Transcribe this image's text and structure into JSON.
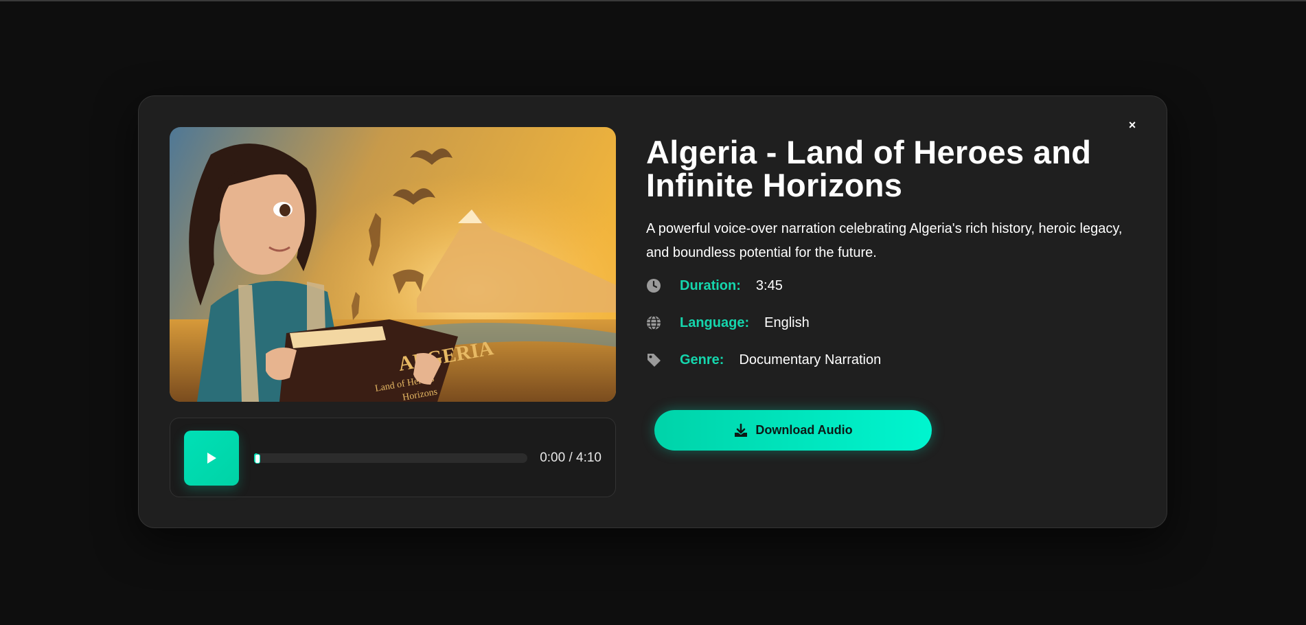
{
  "modal": {
    "close_label": "×",
    "cover": {
      "book_title": "ALGERIA",
      "book_subtitle_1": "Land of Heroes",
      "book_subtitle_2": "Horizons"
    },
    "player": {
      "time": "0:00 / 4:10",
      "progress": 0.0
    },
    "title": "Algeria - Land of Heroes and Infinite Horizons",
    "description": "A powerful voice-over narration celebrating Algeria's rich history, heroic legacy, and boundless potential for the future.",
    "meta": [
      {
        "icon": "clock-icon",
        "label": "Duration:",
        "value": "3:45"
      },
      {
        "icon": "globe-icon",
        "label": "Language:",
        "value": "English"
      },
      {
        "icon": "tag-icon",
        "label": "Genre:",
        "value": "Documentary Narration"
      }
    ],
    "download_label": "Download Audio",
    "colors": {
      "accent": "#00e0b6",
      "label": "#15d6ad",
      "background": "#1f1f1f"
    }
  }
}
